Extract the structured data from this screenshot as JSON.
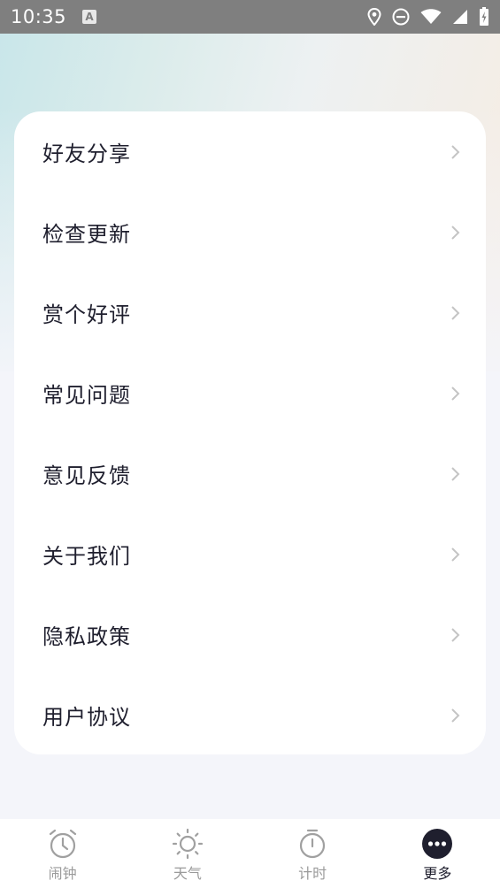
{
  "status_bar": {
    "time": "10:35",
    "notification_icon": "a-icon",
    "icons": [
      "location-icon",
      "dnd-icon",
      "wifi-icon",
      "signal-icon",
      "battery-icon"
    ]
  },
  "menu": {
    "items": [
      {
        "label": "好友分享",
        "icon": "chevron-right-icon"
      },
      {
        "label": "检查更新",
        "icon": "chevron-right-icon"
      },
      {
        "label": "赏个好评",
        "icon": "chevron-right-icon"
      },
      {
        "label": "常见问题",
        "icon": "chevron-right-icon"
      },
      {
        "label": "意见反馈",
        "icon": "chevron-right-icon"
      },
      {
        "label": "关于我们",
        "icon": "chevron-right-icon"
      },
      {
        "label": "隐私政策",
        "icon": "chevron-right-icon"
      },
      {
        "label": "用户协议",
        "icon": "chevron-right-icon"
      }
    ]
  },
  "tab_bar": {
    "tabs": [
      {
        "label": "闹钟",
        "icon": "alarm-clock-icon",
        "active": false
      },
      {
        "label": "天气",
        "icon": "sun-icon",
        "active": false
      },
      {
        "label": "计时",
        "icon": "stopwatch-icon",
        "active": false
      },
      {
        "label": "更多",
        "icon": "more-icon",
        "active": true
      }
    ]
  },
  "colors": {
    "text_primary": "#1f1f2e",
    "text_muted": "#9a9a9a",
    "chevron": "#c4c4c4",
    "page_bg": "#f4f5fa"
  }
}
